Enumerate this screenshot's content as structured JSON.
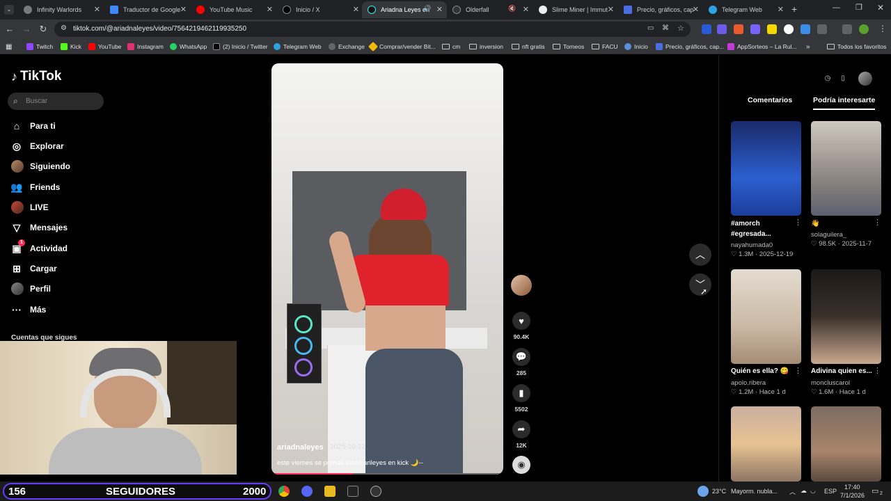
{
  "browser": {
    "tabs": [
      {
        "label": "Infinity Warlords",
        "color": "#7a7a7a"
      },
      {
        "label": "Traductor de Google",
        "color": "#4285f4"
      },
      {
        "label": "YouTube Music",
        "color": "#ff0000"
      },
      {
        "label": "Inicio / X",
        "color": "#000000"
      },
      {
        "label": "Ariadna Leyes en",
        "color": "#111111"
      },
      {
        "label": "Olderfall",
        "color": "#333333"
      },
      {
        "label": "Slime Miner | Immut",
        "color": "#eeeeee"
      },
      {
        "label": "Precio, gráficos, cap",
        "color": "#4a6ee0"
      },
      {
        "label": "Telegram Web",
        "color": "#2aa3e0"
      }
    ],
    "url": "tiktok.com/@ariadnaleyes/video/7564219462119935250",
    "bookmarks": [
      {
        "label": "Twitch",
        "color": "#9146ff"
      },
      {
        "label": "Kick",
        "color": "#53fc18"
      },
      {
        "label": "YouTube",
        "color": "#ff0000"
      },
      {
        "label": "Instagram",
        "color": "#e1306c"
      },
      {
        "label": "WhatsApp",
        "color": "#25d366"
      },
      {
        "label": "(2) Inicio / Twitter",
        "color": "#000000"
      },
      {
        "label": "Telegram Web",
        "color": "#2aa3e0"
      },
      {
        "label": "Exchange",
        "color": "#666666"
      },
      {
        "label": "Comprar/vender Bit...",
        "color": "#f0b90b"
      },
      {
        "label": "cm",
        "color": "folder"
      },
      {
        "label": "inversion",
        "color": "folder"
      },
      {
        "label": "nft gratis",
        "color": "folder"
      },
      {
        "label": "Torneos",
        "color": "folder"
      },
      {
        "label": "FACU",
        "color": "folder"
      },
      {
        "label": "Inicio",
        "color": "#5a8fe0"
      },
      {
        "label": "Precio, gráficos, cap...",
        "color": "#4a6ee0"
      },
      {
        "label": "AppSorteos – La Rul...",
        "color": "#c23ad6"
      }
    ],
    "all_favorites": "Todos los favoritos"
  },
  "tiktok": {
    "logo": "TikTok",
    "search_placeholder": "Buscar",
    "nav": [
      {
        "label": "Para ti",
        "icon": "home-icon"
      },
      {
        "label": "Explorar",
        "icon": "compass-icon"
      },
      {
        "label": "Siguiendo",
        "icon": "avatar"
      },
      {
        "label": "Friends",
        "icon": "users-icon"
      },
      {
        "label": "LIVE",
        "icon": "avatar"
      },
      {
        "label": "Mensajes",
        "icon": "send-icon"
      },
      {
        "label": "Actividad",
        "icon": "inbox-icon"
      },
      {
        "label": "Cargar",
        "icon": "plus-icon"
      },
      {
        "label": "Perfil",
        "icon": "avatar"
      },
      {
        "label": "Más",
        "icon": "more-icon"
      }
    ],
    "activity_badge": "1",
    "following_accounts_title": "Cuentas que sigues",
    "video": {
      "author": "ariadnaleyes",
      "date": "2025-10-22",
      "caption": "este viernes se prende locoo  arileyes en kick 🌙--",
      "progress": 0.35
    },
    "actions": {
      "likes": "90.4K",
      "comments": "285",
      "saves": "5502",
      "shares": "12K"
    },
    "right_tabs": [
      "Comentarios",
      "Podría interesarte"
    ],
    "cards": [
      {
        "title": "#amorch",
        "title2": "#egresada...",
        "author": "nayahumada0",
        "likes": "1.3M",
        "date": "2025-12-19",
        "thumb": "#1f3fae"
      },
      {
        "title": "👋",
        "title2": "",
        "author": "solaguilera_",
        "likes": "98.5K",
        "date": "2025-11-7",
        "thumb": "#a9a199"
      },
      {
        "title": "Quién es ella? 😋",
        "title2": "",
        "author": "apolo.ribera",
        "likes": "1.2M",
        "date": "Hace 1 d",
        "thumb": "#d8cfc3"
      },
      {
        "title": "Adivina quien es...",
        "title2": "",
        "author": "moncluscarol",
        "likes": "1.6M",
        "date": "Hace 1 d",
        "thumb": "#2c2520"
      },
      {
        "title": "",
        "title2": "",
        "author": "",
        "likes": "",
        "date": "",
        "thumb": "#c79a6c"
      },
      {
        "title": "",
        "title2": "",
        "author": "",
        "likes": "",
        "date": "",
        "thumb": "#8a6f5c"
      }
    ]
  },
  "overlay": {
    "followers_count": "156",
    "label": "SEGUIDORES",
    "goal": "2000"
  },
  "taskbar": {
    "weather_temp": "23°C",
    "weather_text": "Mayorm. nubla...",
    "language": "ESP",
    "time": "17:40",
    "date": "7/1/2026",
    "notif_count": "2"
  }
}
